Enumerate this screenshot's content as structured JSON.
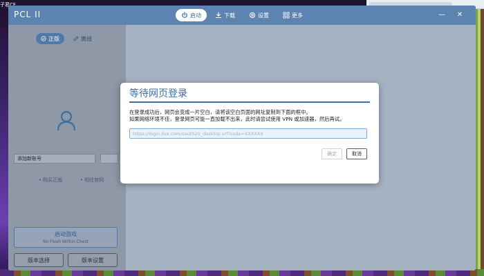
{
  "desktop": {
    "label": "子君CF"
  },
  "app": {
    "title": "PCL II"
  },
  "nav": [
    {
      "label": "启动",
      "icon": "power-icon",
      "active": true
    },
    {
      "label": "下载",
      "icon": "download-icon",
      "active": false
    },
    {
      "label": "设置",
      "icon": "gear-icon",
      "active": false
    },
    {
      "label": "更多",
      "icon": "grid-icon",
      "active": false
    }
  ],
  "window_controls": {
    "minimize": "—",
    "close": "✕"
  },
  "sidebar": {
    "modes": [
      {
        "label": "正版",
        "icon": "shield-check-icon",
        "active": true
      },
      {
        "label": "离线",
        "icon": "link-icon",
        "active": false
      }
    ],
    "account_select": {
      "value": "添加新账号"
    },
    "links": [
      "购买正版",
      "相往官网"
    ],
    "launch": {
      "title": "启动游戏",
      "subtitle": "No Flesh Within Chest"
    },
    "bottom_buttons": [
      "版本选择",
      "版本设置"
    ]
  },
  "dialog": {
    "title": "等待网页登录",
    "message": [
      "在登录成功后，网页会变成一片空白，请将该空白页面的网址复制到下面的框中。",
      "如果网络环境不佳，登录网页可能一直加载不出来，此时请尝试使用 VPN 或加速器，然后再试。"
    ],
    "input_placeholder": "https://login.live.com/oauth20_desktop.srf?code=XXXXXX",
    "confirm_label": "确定",
    "cancel_label": "取消"
  },
  "colors": {
    "titlebar": "#5d84b0",
    "accent": "#3a6fa6",
    "sidebar": "#8f98a6"
  }
}
